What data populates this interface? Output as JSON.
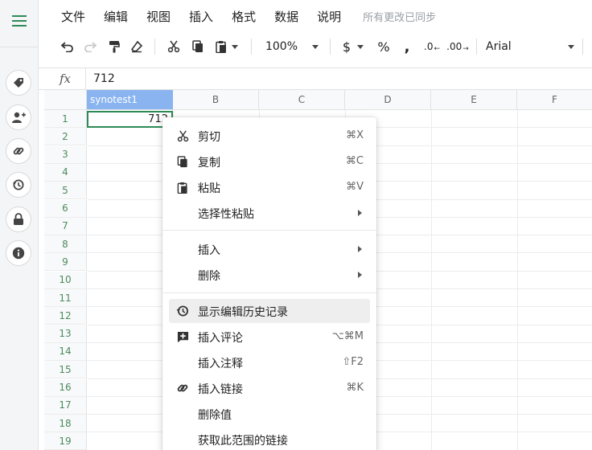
{
  "menubar": {
    "items": [
      "文件",
      "编辑",
      "视图",
      "插入",
      "格式",
      "数据",
      "说明"
    ],
    "sync_status": "所有更改已同步"
  },
  "toolbar": {
    "zoom": "100%",
    "currency": "$",
    "percent": "%",
    "comma": ",",
    "decrease_decimal": ".0",
    "increase_decimal": ".00",
    "font": "Arial"
  },
  "formula_bar": {
    "fx_label": "fx",
    "value": "712"
  },
  "grid": {
    "columns": [
      "synotest1",
      "B",
      "C",
      "D",
      "E",
      "F"
    ],
    "rows": [
      "1",
      "2",
      "3",
      "4",
      "5",
      "6",
      "7",
      "8",
      "9",
      "10",
      "11",
      "12",
      "13",
      "14",
      "15",
      "16",
      "17",
      "18",
      "19"
    ],
    "selected_cell_value": "712"
  },
  "context_menu": {
    "cut": {
      "label": "剪切",
      "shortcut": "⌘X"
    },
    "copy": {
      "label": "复制",
      "shortcut": "⌘C"
    },
    "paste": {
      "label": "粘贴",
      "shortcut": "⌘V"
    },
    "paste_special": {
      "label": "选择性粘贴"
    },
    "insert": {
      "label": "插入"
    },
    "delete": {
      "label": "删除"
    },
    "show_edit_history": {
      "label": "显示编辑历史记录"
    },
    "insert_comment": {
      "label": "插入评论",
      "shortcut": "⌥⌘M"
    },
    "insert_note": {
      "label": "插入注释",
      "shortcut": "⇧F2"
    },
    "insert_link": {
      "label": "插入链接",
      "shortcut": "⌘K"
    },
    "delete_values": {
      "label": "删除值"
    },
    "get_range_link": {
      "label": "获取此范围的链接"
    }
  },
  "colors": {
    "accent_green": "#2e8b57",
    "active_header": "#8ab4f0"
  }
}
